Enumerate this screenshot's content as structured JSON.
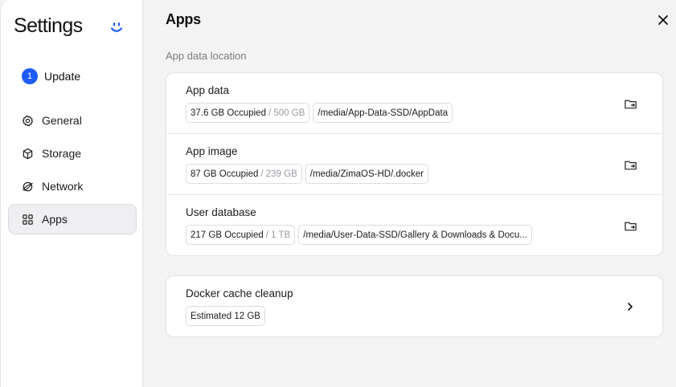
{
  "sidebar": {
    "title": "Settings",
    "update": {
      "badge": "1",
      "label": "Update"
    },
    "items": [
      {
        "label": "General",
        "icon": "gear-icon"
      },
      {
        "label": "Storage",
        "icon": "cube-icon"
      },
      {
        "label": "Network",
        "icon": "globe-icon"
      },
      {
        "label": "Apps",
        "icon": "apps-grid-icon",
        "active": true
      }
    ]
  },
  "main": {
    "title": "Apps",
    "section_label": "App data location",
    "locations": [
      {
        "name": "App data",
        "used": "37.6 GB Occupied",
        "total": "/ 500 GB",
        "path": "/media/App-Data-SSD/AppData"
      },
      {
        "name": "App image",
        "used": "87 GB Occupied",
        "total": "/ 239 GB",
        "path": "/media/ZimaOS-HD/.docker"
      },
      {
        "name": "User database",
        "used": "217 GB Occupied",
        "total": "/ 1 TB",
        "path": "/media/User-Data-SSD/Gallery & Downloads & Docu..."
      }
    ],
    "cleanup": {
      "name": "Docker cache cleanup",
      "estimate": "Estimated 12 GB"
    }
  },
  "colors": {
    "accent": "#1f5bff",
    "background": "#f3f3f4",
    "card": "#ffffff"
  }
}
